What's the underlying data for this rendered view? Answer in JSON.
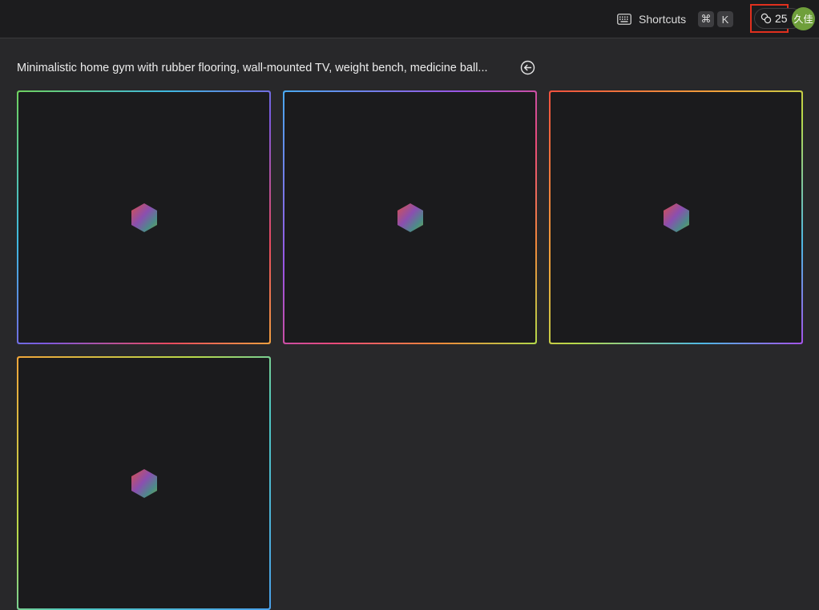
{
  "header": {
    "shortcuts_icon": "keyboard-icon",
    "shortcuts_label": "Shortcuts",
    "shortcut_keys": [
      "⌘",
      "K"
    ],
    "credits_icon": "coins-icon",
    "credits_count": "25",
    "avatar_text": "久佳",
    "avatar_color": "#6f9f3b",
    "highlight_color": "#e0301e"
  },
  "main": {
    "prompt": "Minimalistic home gym with rubber flooring, wall-mounted TV, weight bench, medicine ball...",
    "back_icon": "back-arrow-circle-icon",
    "tiles": [
      {
        "state": "loading",
        "icon": "hexagon-loading-icon"
      },
      {
        "state": "loading",
        "icon": "hexagon-loading-icon"
      },
      {
        "state": "loading",
        "icon": "hexagon-loading-icon"
      },
      {
        "state": "loading",
        "icon": "hexagon-loading-icon"
      }
    ]
  }
}
